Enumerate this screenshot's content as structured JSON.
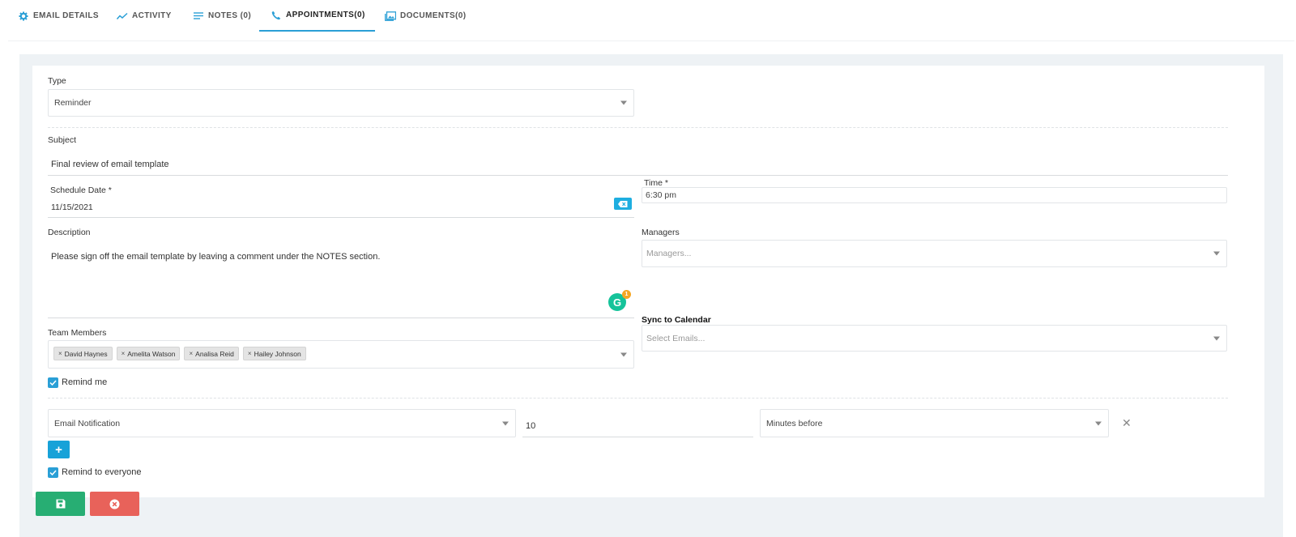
{
  "tabs": [
    {
      "label": "EMAIL DETAILS",
      "icon": "gear-icon"
    },
    {
      "label": "ACTIVITY",
      "icon": "activity-icon"
    },
    {
      "label": "NOTES (0)",
      "icon": "notes-icon"
    },
    {
      "label": "APPOINTMENTS(0)",
      "icon": "phone-icon",
      "active": true
    },
    {
      "label": "DOCUMENTS(0)",
      "icon": "documents-icon"
    }
  ],
  "form": {
    "type": {
      "label": "Type",
      "value": "Reminder"
    },
    "subject": {
      "label": "Subject",
      "value": "Final review of email template"
    },
    "schedule_date": {
      "label": "Schedule Date *",
      "value": "11/15/2021"
    },
    "time": {
      "label": "Time *",
      "value": "6:30 pm"
    },
    "description": {
      "label": "Description",
      "value": "Please sign off the email template by leaving a comment under the NOTES section."
    },
    "grammarly_count": "1",
    "managers": {
      "label": "Managers",
      "placeholder": "Managers..."
    },
    "sync": {
      "label": "Sync to Calendar",
      "placeholder": "Select Emails..."
    },
    "team_members": {
      "label": "Team Members",
      "chips": [
        "David Haynes",
        "Amelita Watson",
        "Analisa Reid",
        "Hailey Johnson"
      ]
    },
    "remind_me": {
      "label": "Remind me",
      "checked": true
    },
    "notification": {
      "method": "Email Notification",
      "amount": "10",
      "unit": "Minutes before"
    },
    "remind_everyone": {
      "label": "Remind to everyone",
      "checked": true
    }
  },
  "colors": {
    "accent": "#2a9fd6",
    "save": "#27ae73",
    "cancel": "#e8625a",
    "panel_bg": "#eef2f5"
  }
}
